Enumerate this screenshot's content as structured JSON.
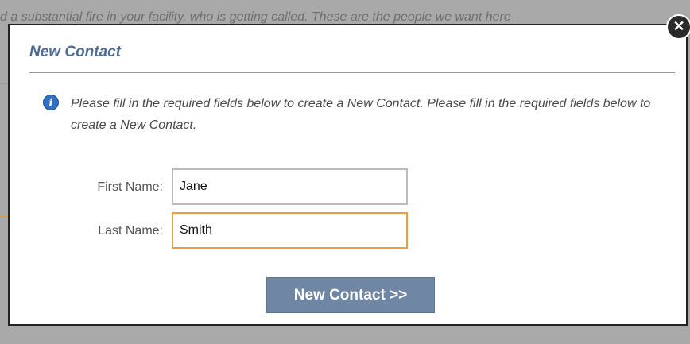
{
  "background": {
    "text": "d a substantial fire in your facility, who is getting called. These are the people we want here"
  },
  "dialog": {
    "title": "New Contact",
    "info_text": "Please fill in the required fields below to create a New Contact. Please fill in the required fields below to create a New Contact.",
    "info_icon": "i",
    "close_icon": "✕",
    "form": {
      "first_name_label": "First Name:",
      "first_name_value": "Jane",
      "last_name_label": "Last Name:",
      "last_name_value": "Smith"
    },
    "submit_label": "New Contact >>"
  },
  "colors": {
    "title": "#4f6b91",
    "button": "#6f87a4",
    "focus_border": "#ef9d3c",
    "info_icon": "#2f6fc4"
  }
}
